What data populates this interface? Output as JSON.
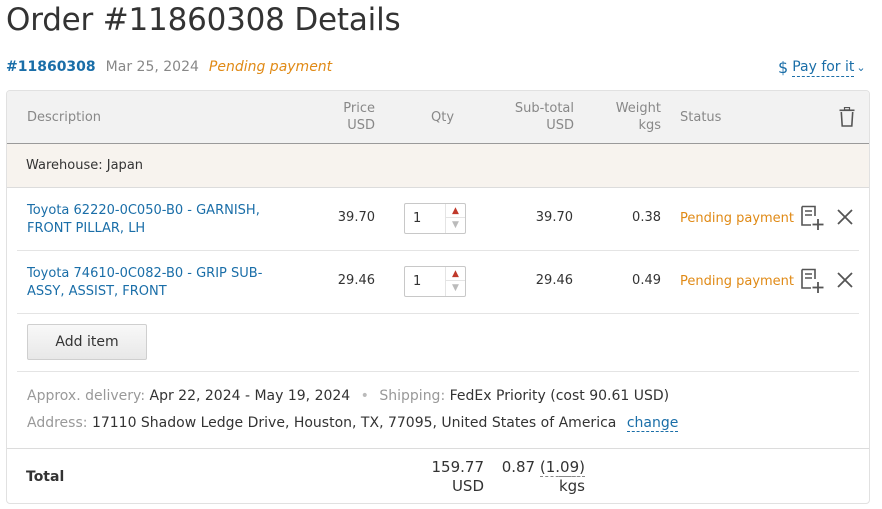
{
  "page": {
    "title": "Order #11860308 Details"
  },
  "order": {
    "number": "#11860308",
    "date": "Mar 25, 2024",
    "status": "Pending payment",
    "pay_label": "Pay for it",
    "pay_icon": "dollar-icon"
  },
  "table": {
    "headers": {
      "description": "Description",
      "price": [
        "Price",
        "USD"
      ],
      "qty": "Qty",
      "subtotal": [
        "Sub-total",
        "USD"
      ],
      "weight": [
        "Weight",
        "kgs"
      ],
      "status": "Status"
    },
    "warehouse": "Warehouse: Japan",
    "items": [
      {
        "description": [
          "Toyota 62220-0C050-B0 - GARNISH,",
          "FRONT PILLAR, LH"
        ],
        "price": "39.70",
        "qty": "1",
        "subtotal": "39.70",
        "weight": "0.38",
        "status": "Pending payment"
      },
      {
        "description": [
          "Toyota 74610-0C082-B0 - GRIP SUB-",
          "ASSY, ASSIST, FRONT"
        ],
        "price": "29.46",
        "qty": "1",
        "subtotal": "29.46",
        "weight": "0.49",
        "status": "Pending payment"
      }
    ],
    "add_item_label": "Add item"
  },
  "delivery": {
    "approx_label": "Approx. delivery:",
    "approx_value": "Apr 22, 2024 - May 19, 2024",
    "separator": "•",
    "shipping_label": "Shipping:",
    "shipping_value": "FedEx Priority (cost 90.61 USD)",
    "address_label": "Address:",
    "address_value": "17110 Shadow Ledge Drive, Houston, TX, 77095, United States of America",
    "change_label": "change"
  },
  "total": {
    "label": "Total",
    "amount": "159.77",
    "currency": "USD",
    "weight": "0.87",
    "weight_volumetric": "(1.09)",
    "weight_unit": "kgs"
  },
  "colors": {
    "link": "#1a6ea8",
    "pending": "#e08a16",
    "header_bg": "#f2f2f2",
    "warehouse_bg": "#f7f3ee"
  }
}
